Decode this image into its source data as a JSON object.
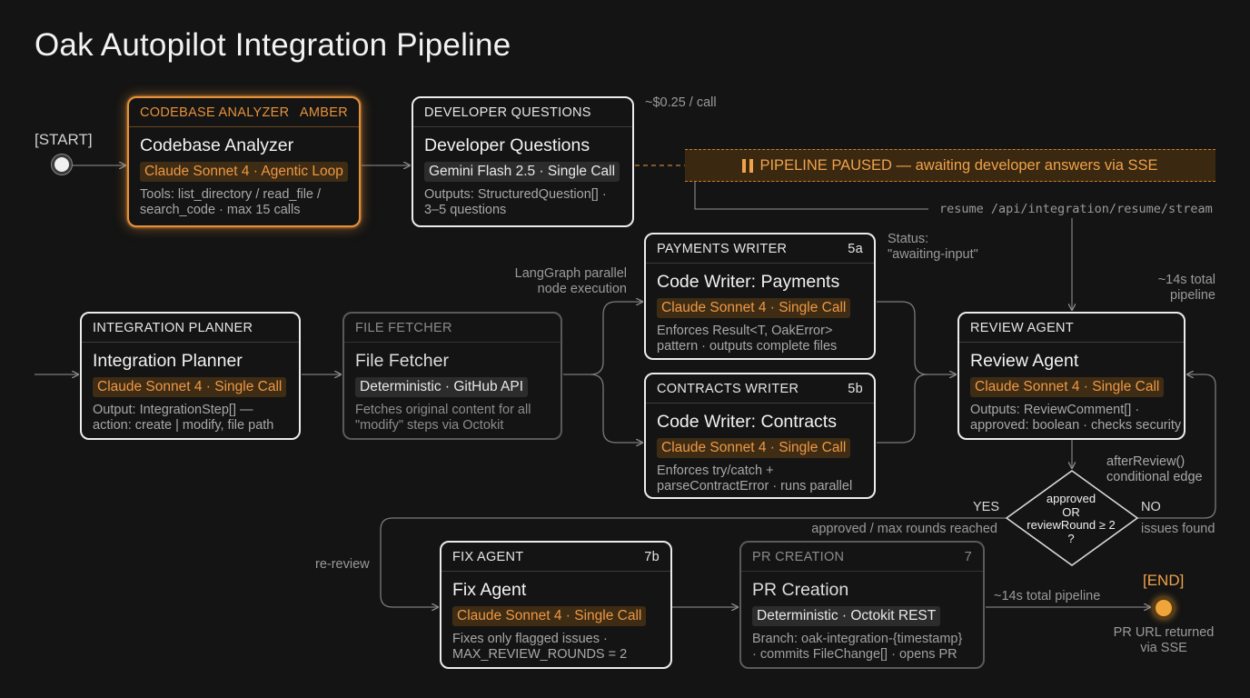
{
  "title": "Oak Autopilot Integration Pipeline",
  "start_label": "[START]",
  "end_label": "[END]",
  "nodes": {
    "analyzer": {
      "header": "CODEBASE ANALYZER",
      "tag": "AMBER",
      "title": "Codebase Analyzer",
      "model": "Claude Sonnet 4 · Agentic Loop",
      "desc1": "Tools: list_directory / read_file /",
      "desc2": "search_code · max 15 calls"
    },
    "questions": {
      "header": "DEVELOPER QUESTIONS",
      "title": "Developer Questions",
      "model": "Gemini Flash 2.5 · Single Call",
      "desc1": "Outputs: StructuredQuestion[] ·",
      "desc2": "3–5 questions"
    },
    "planner": {
      "header": "INTEGRATION PLANNER",
      "title": "Integration Planner",
      "model": "Claude Sonnet 4 · Single Call",
      "desc1": "Output: IntegrationStep[] —",
      "desc2": "action: create | modify, file path"
    },
    "fetcher": {
      "header": "FILE FETCHER",
      "title": "File Fetcher",
      "model": "Deterministic · GitHub API",
      "desc1": "Fetches original content for all",
      "desc2": "\"modify\" steps via Octokit"
    },
    "payments": {
      "header": "PAYMENTS WRITER",
      "tag": "5a",
      "title": "Code Writer: Payments",
      "model": "Claude Sonnet 4 · Single Call",
      "desc1": "Enforces Result<T, OakError>",
      "desc2": "pattern · outputs complete files"
    },
    "contracts": {
      "header": "CONTRACTS WRITER",
      "tag": "5b",
      "title": "Code Writer: Contracts",
      "model": "Claude Sonnet 4 · Single Call",
      "desc1": "Enforces try/catch +",
      "desc2": "parseContractError · runs parallel"
    },
    "review": {
      "header": "REVIEW AGENT",
      "title": "Review Agent",
      "model": "Claude Sonnet 4 · Single Call",
      "desc1": "Outputs: ReviewComment[] ·",
      "desc2": "approved: boolean · checks security"
    },
    "fix": {
      "header": "FIX AGENT",
      "tag": "7b",
      "title": "Fix Agent",
      "model": "Claude Sonnet 4 · Single Call",
      "desc1": "Fixes only flagged issues ·",
      "desc2": "MAX_REVIEW_ROUNDS = 2"
    },
    "pr": {
      "header": "PR CREATION",
      "tag": "7",
      "title": "PR Creation",
      "model": "Deterministic · Octokit REST",
      "desc1": "Branch: oak-integration-{timestamp}",
      "desc2": "· commits FileChange[] · opens PR"
    }
  },
  "paused_banner": "PIPELINE PAUSED — awaiting developer answers via SSE",
  "annotations": {
    "cost": "~$0.25 / call",
    "resume": "resume /api/integration/resume/stream",
    "status_1": "Status:",
    "status_2": "\"awaiting-input\"",
    "langgraph_1": "LangGraph parallel",
    "langgraph_2": "node execution",
    "total_1": "~14s total",
    "total_2": "pipeline",
    "after_review_1": "afterReview()",
    "after_review_2": "conditional edge",
    "yes": "YES",
    "no": "NO",
    "approved_reached": "approved / max rounds reached",
    "issues_found": "issues found",
    "re_review": "re-review",
    "total_pipeline": "~14s total pipeline",
    "pr_url_1": "PR URL returned",
    "pr_url_2": "via SSE"
  },
  "decision": {
    "line1": "approved",
    "line2": "OR",
    "line3": "reviewRound ≥ 2",
    "line4": "?"
  },
  "colors": {
    "background": "#141414",
    "amber": "#e6913a",
    "node_border": "#ececec",
    "dim_border": "#5a5a5a"
  }
}
